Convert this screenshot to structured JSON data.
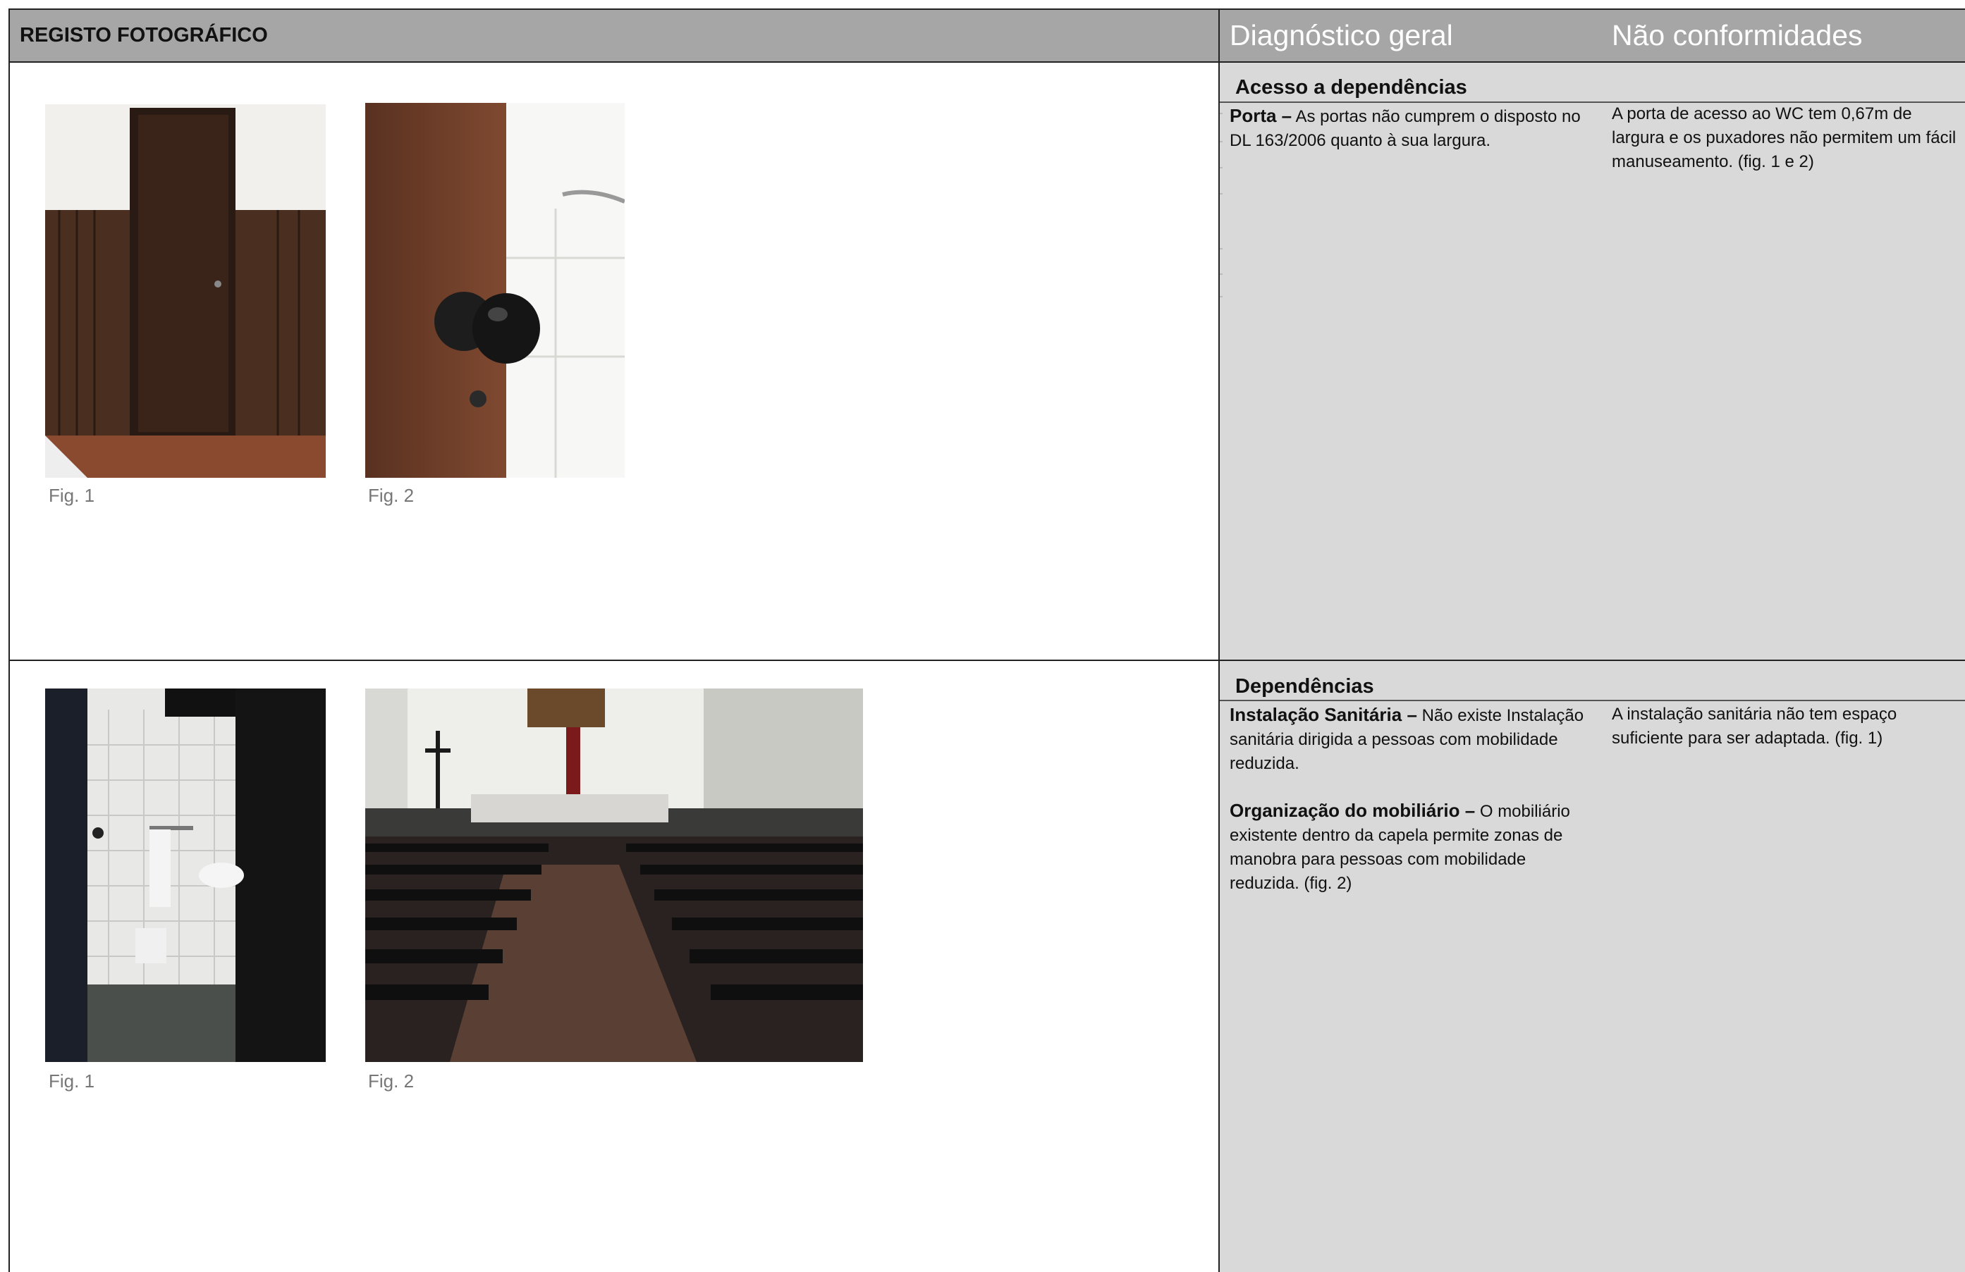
{
  "header": {
    "left_title": "REGISTO FOTOGRÁFICO",
    "col1_title": "Diagnóstico geral",
    "col2_title": "Não conformidades"
  },
  "section1": {
    "title": "Acesso a dependências",
    "item_label": "Porta –",
    "item_text": " As portas não cumprem o disposto no DL 163/2006 quanto à sua largura.",
    "nonconformity": "A porta de acesso ao WC tem 0,67m de largura e os puxadores não permitem um fácil manuseamento. (fig. 1 e 2)",
    "fig1": "Fig. 1",
    "fig2": "Fig. 2"
  },
  "section2": {
    "title": "Dependências",
    "item1_label": "Instalação Sanitária –",
    "item1_text": " Não existe Instalação sanitária dirigida a pessoas com mobilidade reduzida.",
    "item2_label": "Organização do mobiliário –",
    "item2_text": " O mobiliário existente dentro da capela permite zonas de manobra para pessoas com mobilidade reduzida. (fig. 2)",
    "nonconformity": "A instalação sanitária não tem espaço suficiente para ser adaptada. (fig. 1)",
    "fig1": "Fig. 1",
    "fig2": "Fig. 2"
  }
}
